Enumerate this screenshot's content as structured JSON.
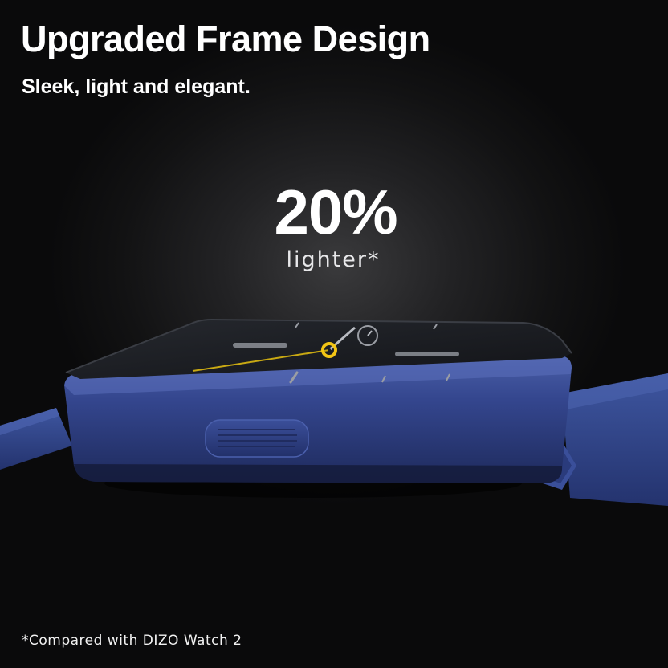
{
  "headline": "Upgraded Frame Design",
  "subline": "Sleek, light and elegant.",
  "stat": {
    "value": "20%",
    "caption": "lighter*"
  },
  "footnote": "*Compared with DIZO Watch 2",
  "colors": {
    "frame_blue": "#2e3f82",
    "frame_highlight": "#4a5fa8",
    "screen": "#16181c",
    "accent_yellow": "#f3c515",
    "text": "#ffffff"
  }
}
